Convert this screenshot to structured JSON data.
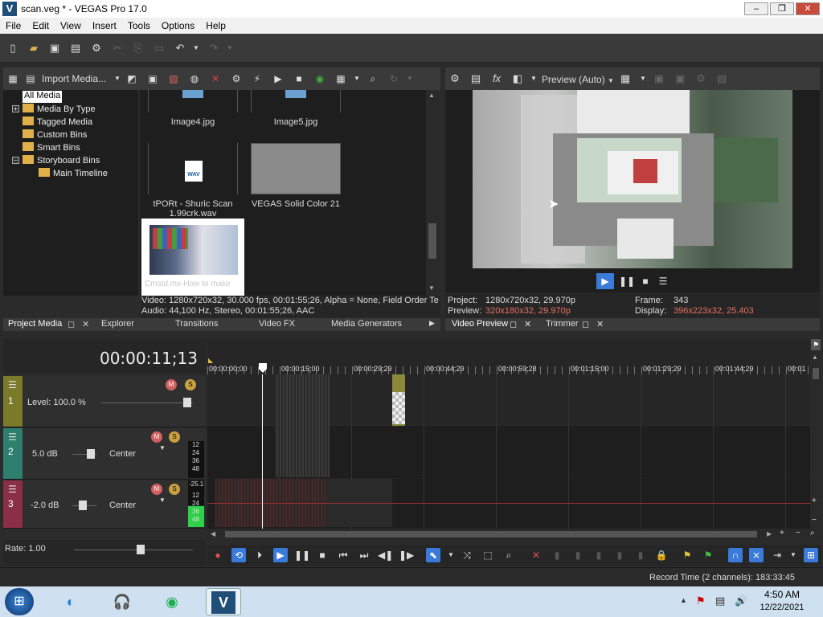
{
  "window": {
    "title": "scan.veg * - VEGAS Pro 17.0",
    "logo": "V",
    "minimize": "‒",
    "maximize": "❐",
    "close": "✕"
  },
  "menu": [
    "File",
    "Edit",
    "View",
    "Insert",
    "Tools",
    "Options",
    "Help"
  ],
  "project_media": {
    "import_label": "Import Media...",
    "tree": [
      {
        "label": "All Media",
        "selected": true
      },
      {
        "label": "Media By Type",
        "expander": "+"
      },
      {
        "label": "Tagged Media"
      },
      {
        "label": "Custom Bins"
      },
      {
        "label": "Smart Bins"
      },
      {
        "label": "Storyboard Bins",
        "expander": "−"
      },
      {
        "label": "Main Timeline",
        "indent": true
      }
    ],
    "items": [
      {
        "name": "Image4.jpg"
      },
      {
        "name": "Image5.jpg"
      },
      {
        "name_line1": "tPORt - Shuric Scan",
        "name_line2": "1.99crk.wav",
        "badge": "WAV"
      },
      {
        "name": "VEGAS Solid Color 21"
      },
      {
        "name": "Cmstd.mx-How to make"
      }
    ],
    "info_video": "Video: 1280x720x32, 30.000 fps, 00:01:55;26, Alpha = None, Field Order Te",
    "info_audio": "Audio: 44,100 Hz, Stereo, 00:01:55;26, AAC"
  },
  "left_tabs": [
    "Project Media",
    "Explorer",
    "Transitions",
    "Video FX",
    "Media Generators"
  ],
  "preview": {
    "mode": "Preview (Auto)",
    "project_label": "Project:",
    "project_value": "1280x720x32, 29.970p",
    "preview_label": "Preview:",
    "preview_value": "320x180x32, 29.970p",
    "frame_label": "Frame:",
    "frame_value": "343",
    "display_label": "Display:",
    "display_value": "396x223x32, 25.403"
  },
  "right_tabs": [
    "Video Preview",
    "Trimmer"
  ],
  "timeline": {
    "timecode": "00:00:11;13",
    "ruler_marks": [
      "00:00:00;00",
      "00:00:15;00",
      "00:00:29;29",
      "00:00:44;29",
      "00:00:59;28",
      "00:01:15;00",
      "00:01:29;29",
      "00:01:44;29",
      "00:01"
    ],
    "tracks": [
      {
        "number": "1",
        "level": "Level: 100.0 %",
        "color": "#7a7a2a"
      },
      {
        "number": "2",
        "volume": "5.0 dB",
        "pan": "Center",
        "color": "#2f7f6f",
        "meter": [
          "12",
          "24",
          "36",
          "48"
        ]
      },
      {
        "number": "3",
        "volume": "-2.0 dB",
        "pan": "Center",
        "color": "#8a2f45",
        "meter": [
          "-25.1",
          "12",
          "24",
          "36",
          "48"
        ]
      }
    ],
    "rate": "Rate: 1.00"
  },
  "status": {
    "record_time": "Record Time (2 channels): 183:33:45"
  },
  "taskbar": {
    "time": "4:50 AM",
    "date": "12/22/2021",
    "vegas_version": "17"
  }
}
